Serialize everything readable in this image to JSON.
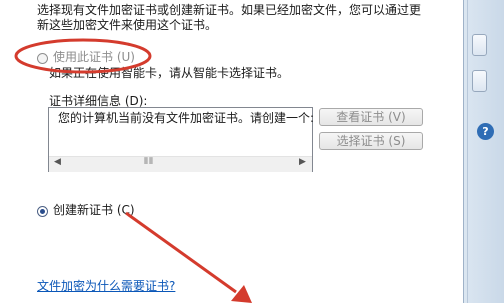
{
  "intro": {
    "line1": "选择现有文件加密证书或创建新证书。如果已经加密文件，您可以通过更",
    "line2": "新这些加密文件来使用这个证书。"
  },
  "use_this_cert": {
    "label": "使用此证书 (U)",
    "note": "如果正在使用智能卡，请从智能卡选择证书。",
    "checked": false,
    "enabled": false
  },
  "cert_details": {
    "label": "证书详细信息 (D):",
    "text": "您的计算机当前没有文件加密证书。请创建一个:"
  },
  "buttons": {
    "view": "查看证书 (V)",
    "select": "选择证书 (S)"
  },
  "create_new": {
    "label": "创建新证书 (C)",
    "checked": true
  },
  "help_link": "文件加密为什么需要证书?",
  "colors": {
    "annotation_red": "#d43b2d",
    "link_blue": "#0b57b8"
  },
  "side_panel": {
    "help_glyph": "?"
  }
}
